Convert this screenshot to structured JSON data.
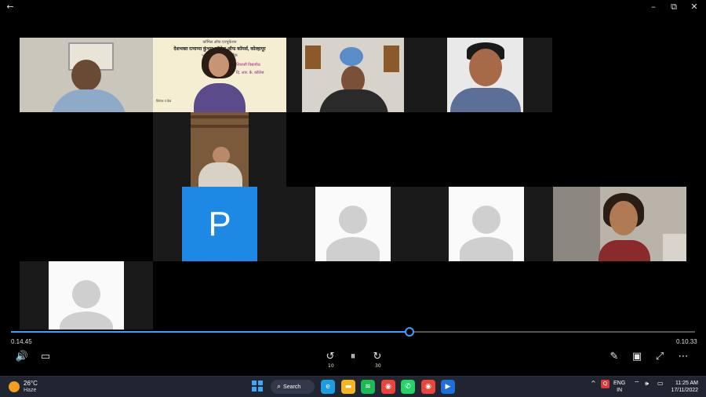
{
  "window": {
    "back_glyph": "←",
    "minimize_glyph": "–",
    "restore_glyph": "⧉",
    "close_glyph": "✕"
  },
  "meeting": {
    "participant_initial": "P",
    "poster_lines": [
      "कॉमिल ऑफ एज्युकेशन",
      "देशभक्त रत्नाप्पा कुंभार कॉलेज ऑफ कॉमर्स, कोल्हापूर",
      "५०९, ए वॉर्ड आझाद चौक",
      "शिवाजी विद्यापीठ",
      "दि. आर. के. कॉलेज",
      "दिनांक व वेळ"
    ]
  },
  "player": {
    "elapsed": "0.14.45",
    "remaining": "0.10.33",
    "progress": 0.582,
    "volume_glyph": "🔊",
    "captions_glyph": "▭",
    "rewind_label": "10",
    "rewind_glyph": "↺",
    "pause_glyph": "⏸",
    "forward_label": "30",
    "forward_glyph": "↻",
    "edit_glyph": "✎",
    "miniplayer_glyph": "▣",
    "fullscreen_glyph": "⤢",
    "more_glyph": "⋯"
  },
  "taskbar": {
    "weather_temp": "26°C",
    "weather_condition": "Haze",
    "search_label": "Search",
    "search_glyph": "⌕",
    "apps": [
      {
        "name": "edge",
        "color": "#1b9de2",
        "glyph": "e"
      },
      {
        "name": "file-explorer",
        "color": "#f3b61f",
        "glyph": "▬"
      },
      {
        "name": "spotify",
        "color": "#1db954",
        "glyph": "≋"
      },
      {
        "name": "chrome",
        "color": "#e8453c",
        "glyph": "◉"
      },
      {
        "name": "whatsapp",
        "color": "#25d366",
        "glyph": "✆"
      },
      {
        "name": "chrome-profile",
        "color": "#e8453c",
        "glyph": "◉"
      },
      {
        "name": "media-player",
        "color": "#1e6fd9",
        "glyph": "▶"
      }
    ],
    "tray_chevron": "^",
    "tray_app_glyph": "Q",
    "lang_primary": "ENG",
    "lang_secondary": "IN",
    "wifi_glyph": "⌔",
    "volume_glyph": "🕪",
    "battery_glyph": "▭",
    "time": "11:25 AM",
    "date": "17/11/2022"
  }
}
